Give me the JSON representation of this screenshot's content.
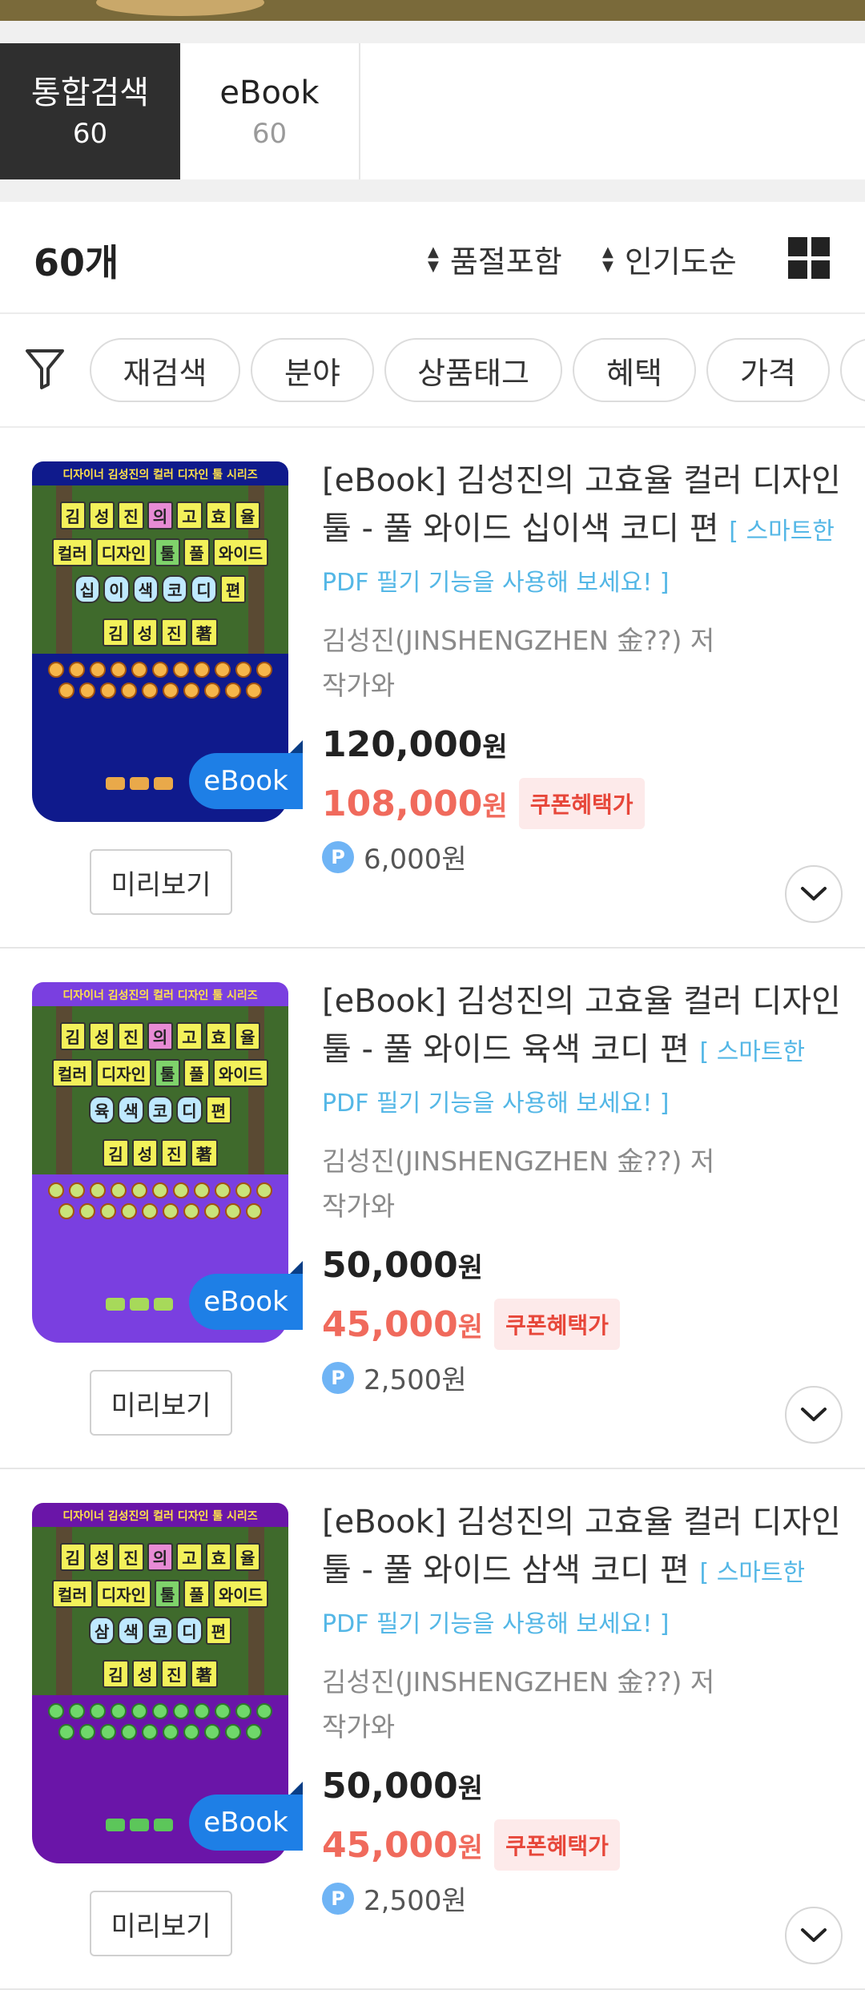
{
  "tabs": [
    {
      "label": "통합검색",
      "count": "60"
    },
    {
      "label": "eBook",
      "count": "60"
    }
  ],
  "results": {
    "count": "60개",
    "sort_primary": "품절포함",
    "sort_secondary": "인기도순"
  },
  "filters": [
    "재검색",
    "분야",
    "상품태그",
    "혜택",
    "가격"
  ],
  "items": [
    {
      "title": "[eBook] 김성진의 고효율 컬러 디자인 툴 - 풀 와이드 십이색 코디 편",
      "promo": "[ 스마트한 PDF 필기 기능을 사용해 보세요! ]",
      "author": "김성진(JINSHENGZHEN 金??) 저",
      "publisher": "작가와",
      "price": "120,000",
      "sale_price": "108,000",
      "coupon": "쿠폰혜택가",
      "points": "6,000원",
      "badge": "eBook",
      "preview": "미리보기",
      "cover_color": "#0f1a8c"
    },
    {
      "title": "[eBook] 김성진의 고효율 컬러 디자인 툴 - 풀 와이드 육색 코디 편",
      "promo": "[ 스마트한 PDF 필기 기능을 사용해 보세요! ]",
      "author": "김성진(JINSHENGZHEN 金??) 저",
      "publisher": "작가와",
      "price": "50,000",
      "sale_price": "45,000",
      "coupon": "쿠폰혜택가",
      "points": "2,500원",
      "badge": "eBook",
      "preview": "미리보기",
      "cover_color": "#7a3fe0"
    },
    {
      "title": "[eBook] 김성진의 고효율 컬러 디자인 툴 - 풀 와이드 삼색 코디 편",
      "promo": "[ 스마트한 PDF 필기 기능을 사용해 보세요! ]",
      "author": "김성진(JINSHENGZHEN 金??) 저",
      "publisher": "작가와",
      "price": "50,000",
      "sale_price": "45,000",
      "coupon": "쿠폰혜택가",
      "points": "2,500원",
      "badge": "eBook",
      "preview": "미리보기",
      "cover_color": "#6a15a8"
    }
  ],
  "cover_text": {
    "series": "디자이너 김성진의 컬러 디자인 툴 시리즈",
    "row1": [
      "김",
      "성",
      "진",
      "의",
      "고",
      "효",
      "율"
    ],
    "row2": [
      "컬러",
      "디자인",
      "툴",
      "풀",
      "와이드"
    ],
    "row3_item1": [
      "십",
      "이",
      "색",
      "코",
      "디",
      "편"
    ],
    "row3_item2": [
      "육",
      "색",
      "코",
      "디",
      "편"
    ],
    "row3_item3": [
      "삼",
      "색",
      "코",
      "디",
      "편"
    ],
    "author_tag": [
      "김",
      "성",
      "진",
      "著"
    ]
  },
  "currency": "원",
  "point_symbol": "P",
  "colors": {
    "accent_sale": "#f06a5c",
    "ebook_badge": "#1e7fe6",
    "promo": "#54b7e6",
    "active_tab": "#2f2f2f"
  }
}
